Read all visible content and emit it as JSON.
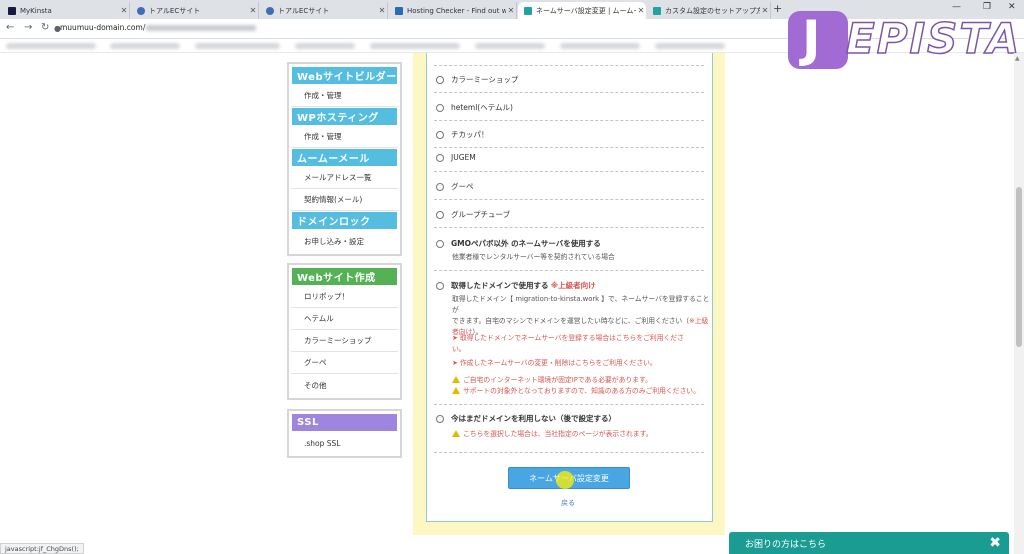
{
  "browser": {
    "tabs": [
      {
        "title": "MyKinsta",
        "color": "#1a1a40"
      },
      {
        "title": "トアルECサイト",
        "color": "#3d6fb4"
      },
      {
        "title": "トアルECサイト",
        "color": "#3d6fb4"
      },
      {
        "title": "Hosting Checker - Find out who",
        "color": "#2b6cb0"
      },
      {
        "title": "ネームサーバ設定変更 | ムームードメイ",
        "color": "#1fa3a3"
      },
      {
        "title": "カスタム設定のセットアップ方法 | ムー",
        "color": "#1fa3a3"
      }
    ],
    "new_tab": "+",
    "url_host": "muumuu-domain.com/"
  },
  "logo": {
    "j": "J",
    "rest": "EPISTA"
  },
  "sidebar": {
    "groups": [
      {
        "head": "Webサイトビルダー",
        "items": [
          "作成・管理"
        ]
      },
      {
        "head": "WPホスティング",
        "items": [
          "作成・管理"
        ]
      },
      {
        "head": "ムームーメール",
        "items": [
          "メールアドレス一覧",
          "契約情報(メール)"
        ]
      },
      {
        "head": "ドメインロック",
        "items": [
          "お申し込み・設定"
        ]
      }
    ],
    "webcreate": {
      "head": "Webサイト作成",
      "items": [
        "ロリポップ！",
        "ヘテムル",
        "カラーミーショップ",
        "グーペ",
        "その他"
      ]
    },
    "ssl": {
      "head": "SSL",
      "items": [
        ".shop SSL"
      ]
    }
  },
  "main": {
    "options": [
      {
        "label": "カラーミーショップ"
      },
      {
        "label": "heteml(ヘテムル)"
      },
      {
        "label": "チカッパ！"
      },
      {
        "label": "JUGEM"
      },
      {
        "label": "グーペ"
      },
      {
        "label": "グループチューブ"
      },
      {
        "label": "GMOペパボ以外 のネームサーバを使用する",
        "sub": "他業者様でレンタルサーバー等を契約されている場合"
      },
      {
        "label": "取得したドメインで使用する",
        "badge": "※上級者向け"
      },
      {
        "label": "今はまだドメインを利用しない（後で設定する）"
      }
    ],
    "custom_desc_1": "取得したドメイン【 migration-to-kinsta.work 】で、ネームサーバを登録することが",
    "custom_desc_2": "できます。自宅のマシンでドメインを運営したい時などに、ご利用ください（",
    "custom_desc_2_red": "※上級",
    "custom_desc_3_red": "者向け",
    "custom_desc_3_end": "）。",
    "link_1a": "取得したドメインでネームサーバを登録する場合はこちらをご利用くださ",
    "link_1b": "い。",
    "link_2": "作成したネームサーバの変更・削除はこちらをご利用ください。",
    "warn_1": "ご自宅のインターネット環境が固定IPである必要があります。",
    "warn_2": "サポートの対象外となっておりますので、知識のある方のみご利用ください。",
    "warn_later": "こちらを選択した場合は、当社指定のページが表示されます。",
    "submit": "ネームサーバ設定変更",
    "back": "戻る"
  },
  "help": {
    "label": "お困りの方はこちら",
    "close": "✖"
  },
  "status": "javascript:jf_ChgDns();"
}
